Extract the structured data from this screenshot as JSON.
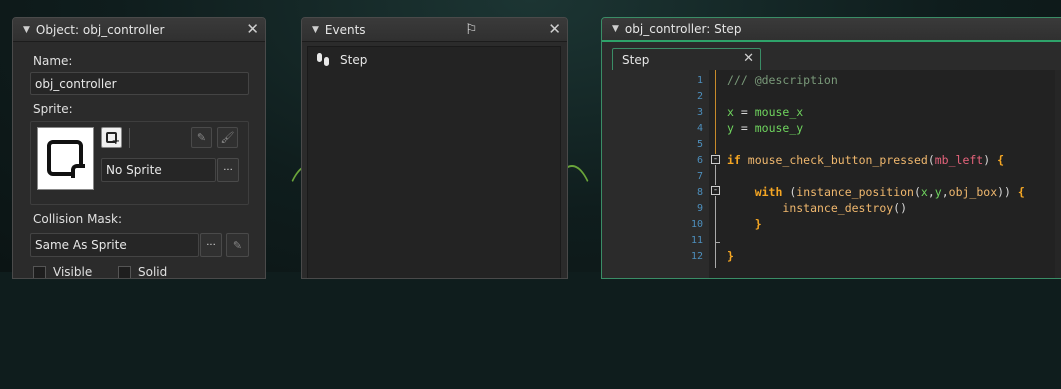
{
  "object_panel": {
    "title": "Object: obj_controller",
    "name_label": "Name:",
    "name_value": "obj_controller",
    "sprite_label": "Sprite:",
    "sprite_value": "No Sprite",
    "menu_dots": "···",
    "collision_label": "Collision Mask:",
    "collision_value": "Same As Sprite",
    "visible_label": "Visible",
    "solid_label": "Solid"
  },
  "events_panel": {
    "title": "Events",
    "events": [
      {
        "label": "Step"
      }
    ]
  },
  "code_panel": {
    "title": "obj_controller: Step",
    "tab_label": "Step",
    "line_numbers": [
      "1",
      "2",
      "3",
      "4",
      "5",
      "6",
      "7",
      "8",
      "9",
      "10",
      "11",
      "12"
    ]
  },
  "icons": {
    "close": "close-icon",
    "collapse": "triangle-down-icon",
    "flag": "flag-icon",
    "footsteps": "footsteps-icon",
    "edit": "edit-icon",
    "brush": "brush-icon",
    "new_sprite": "new-sprite-icon",
    "fold": "fold-minus-icon"
  },
  "colors": {
    "accent_green": "#2ea36a",
    "line_number_blue": "#4d8fbd",
    "keyword_orange": "#f5a623",
    "variable_green": "#6fd45e",
    "constant_red": "#e5637b"
  }
}
